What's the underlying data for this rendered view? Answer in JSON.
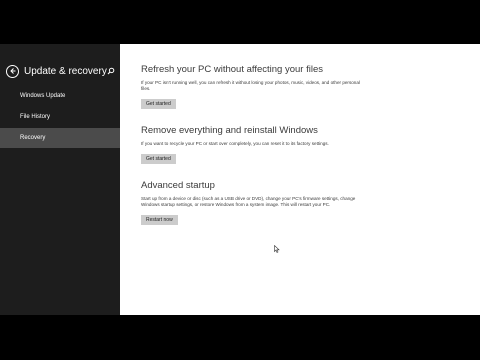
{
  "sidebar": {
    "title": "Update & recovery",
    "back_icon": "back-arrow-icon",
    "search_icon": "search-icon",
    "items": [
      {
        "label": "Windows Update",
        "active": false
      },
      {
        "label": "File History",
        "active": false
      },
      {
        "label": "Recovery",
        "active": true
      }
    ]
  },
  "main": {
    "refresh": {
      "heading": "Refresh your PC without affecting your files",
      "description": "If your PC isn't running well, you can refresh it without losing your photos, music, videos, and other personal files.",
      "button": "Get started"
    },
    "remove": {
      "heading": "Remove everything and reinstall Windows",
      "description": "If you want to recycle your PC or start over completely, you can reset it to its factory settings.",
      "button": "Get started"
    },
    "advanced": {
      "heading": "Advanced startup",
      "description": "Start up from a device or disc (such as a USB drive or DVD), change your PC's firmware settings, change Windows startup settings, or restore Windows from a system image. This will restart your PC.",
      "button": "Restart now"
    }
  },
  "colors": {
    "sidebar_bg": "#1d1d1d",
    "active_item_bg": "#4b4b4b",
    "content_bg": "#ffffff",
    "button_bg": "#cccccc"
  }
}
